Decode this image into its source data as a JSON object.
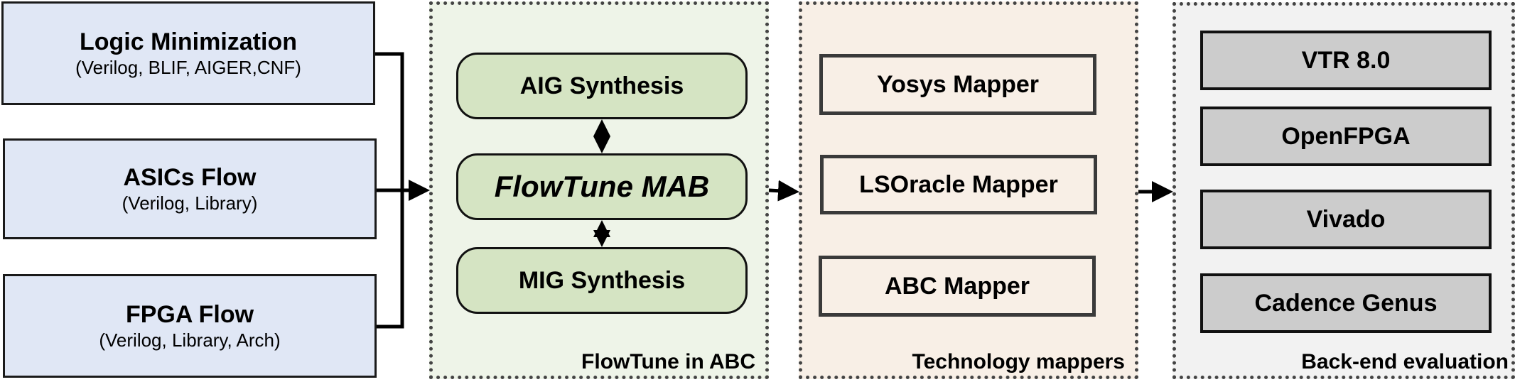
{
  "inputs": [
    {
      "title": "Logic Minimization",
      "subtitle": "(Verilog, BLIF, AIGER,CNF)"
    },
    {
      "title": "ASICs Flow",
      "subtitle": "(Verilog, Library)"
    },
    {
      "title": "FPGA Flow",
      "subtitle": "(Verilog, Library, Arch)"
    }
  ],
  "flowtune": {
    "label": "FlowTune in ABC",
    "blocks": [
      "AIG Synthesis",
      "FlowTune MAB",
      "MIG Synthesis"
    ],
    "color": "#eef4e8"
  },
  "mappers": {
    "label": "Technology mappers",
    "blocks": [
      "Yosys Mapper",
      "LSOracle Mapper",
      "ABC Mapper"
    ],
    "color": "#f8efe6"
  },
  "backend": {
    "label": "Back-end evaluation",
    "blocks": [
      "VTR 8.0",
      "OpenFPGA",
      "Vivado",
      "Cadence Genus"
    ],
    "color": "#f2f2f2"
  }
}
